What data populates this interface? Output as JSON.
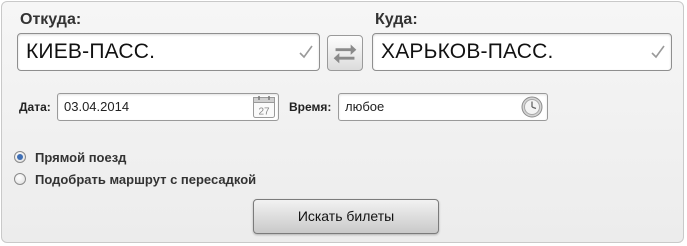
{
  "from": {
    "label": "Откуда:",
    "value": "КИЕВ-ПАСС."
  },
  "to": {
    "label": "Куда:",
    "value": "ХАРЬКОВ-ПАСС."
  },
  "date": {
    "label": "Дата:",
    "value": "03.04.2014",
    "calendar_day": "27"
  },
  "time": {
    "label": "Время:",
    "value": "любое"
  },
  "route_options": [
    {
      "label": "Прямой поезд",
      "selected": true
    },
    {
      "label": "Подобрать маршрут с пересадкой",
      "selected": false
    }
  ],
  "search_button_label": "Искать билеты",
  "colors": {
    "accent": "#3f6fb5",
    "panel_bg": "#efefef",
    "border": "#8f8f8f"
  },
  "icons": [
    "check-icon",
    "swap-arrows-icon",
    "calendar-icon",
    "clock-icon"
  ]
}
